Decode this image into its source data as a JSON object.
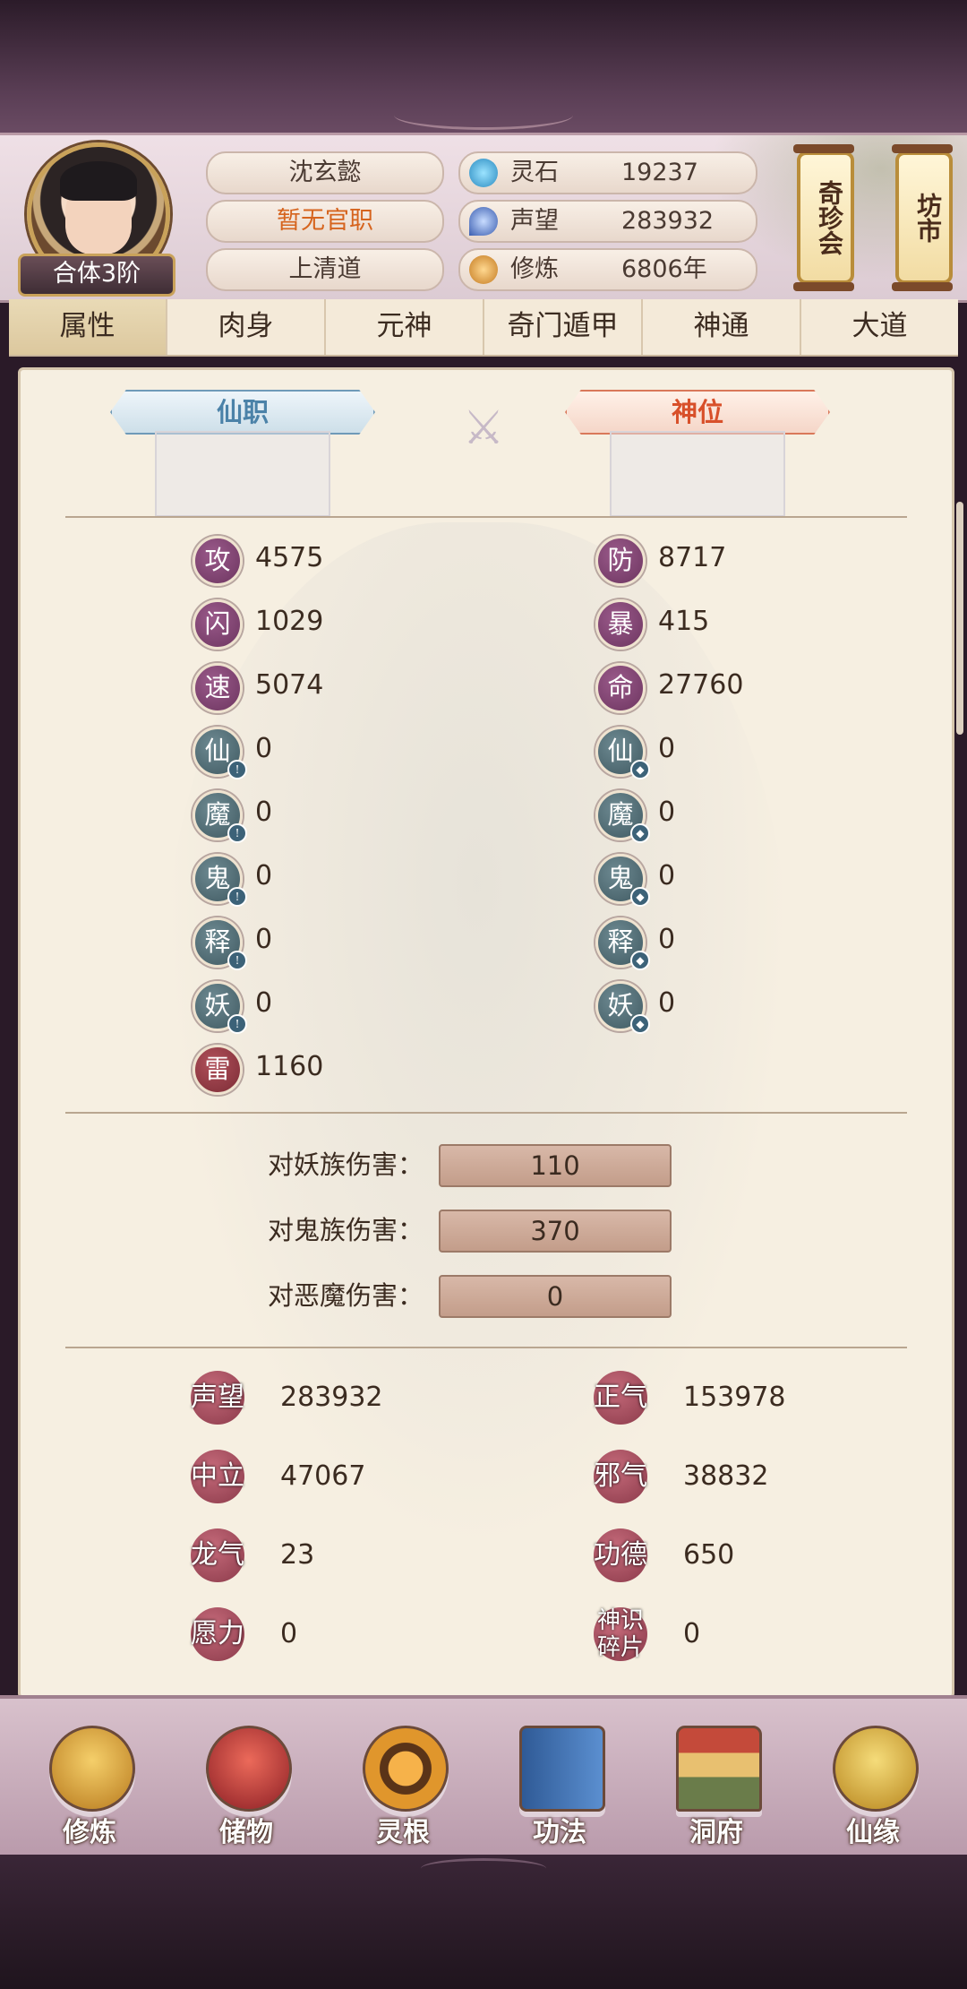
{
  "header": {
    "realm_badge": "合体3阶",
    "name": "沈玄懿",
    "official_title": "暂无官职",
    "sect": "上清道",
    "resources": [
      {
        "label": "灵石",
        "value": "19237",
        "icon": "spirit-stone-icon",
        "color": "#3aa6d8"
      },
      {
        "label": "声望",
        "value": "283932",
        "icon": "reputation-icon",
        "color": "#4a6fc4"
      },
      {
        "label": "修炼",
        "value": "6806年",
        "icon": "cultivation-icon",
        "color": "#d89a3a"
      }
    ],
    "shortcuts": [
      {
        "label": "奇珍会",
        "icon": "treasure-fair-scroll"
      },
      {
        "label": "坊市",
        "icon": "market-scroll"
      }
    ]
  },
  "tabs": [
    {
      "label": "属性",
      "active": true
    },
    {
      "label": "肉身",
      "active": false
    },
    {
      "label": "元神",
      "active": false
    },
    {
      "label": "奇门遁甲",
      "active": false
    },
    {
      "label": "神通",
      "active": false
    },
    {
      "label": "大道",
      "active": false
    }
  ],
  "ranks": {
    "left_label": "仙职",
    "right_label": "神位"
  },
  "stats_left": [
    {
      "char": "攻",
      "value": "4575",
      "kind": "purple"
    },
    {
      "char": "闪",
      "value": "1029",
      "kind": "purple"
    },
    {
      "char": "速",
      "value": "5074",
      "kind": "purple"
    },
    {
      "char": "仙",
      "value": "0",
      "kind": "teal"
    },
    {
      "char": "魔",
      "value": "0",
      "kind": "teal"
    },
    {
      "char": "鬼",
      "value": "0",
      "kind": "teal"
    },
    {
      "char": "释",
      "value": "0",
      "kind": "teal"
    },
    {
      "char": "妖",
      "value": "0",
      "kind": "teal"
    },
    {
      "char": "雷",
      "value": "1160",
      "kind": "red"
    }
  ],
  "stats_right": [
    {
      "char": "防",
      "value": "8717",
      "kind": "purple"
    },
    {
      "char": "暴",
      "value": "415",
      "kind": "purple"
    },
    {
      "char": "命",
      "value": "27760",
      "kind": "purple"
    },
    {
      "char": "仙",
      "value": "0",
      "kind": "teal"
    },
    {
      "char": "魔",
      "value": "0",
      "kind": "teal"
    },
    {
      "char": "鬼",
      "value": "0",
      "kind": "teal"
    },
    {
      "char": "释",
      "value": "0",
      "kind": "teal"
    },
    {
      "char": "妖",
      "value": "0",
      "kind": "teal"
    }
  ],
  "damage": [
    {
      "label": "对妖族伤害：",
      "value": "110"
    },
    {
      "label": "对鬼族伤害：",
      "value": "370"
    },
    {
      "label": "对恶魔伤害：",
      "value": "0"
    }
  ],
  "extras_left": [
    {
      "label": "声望",
      "value": "283932"
    },
    {
      "label": "中立",
      "value": "47067"
    },
    {
      "label": "龙气",
      "value": "23"
    },
    {
      "label": "愿力",
      "value": "0"
    }
  ],
  "extras_right": [
    {
      "label": "正气",
      "value": "153978"
    },
    {
      "label": "邪气",
      "value": "38832"
    },
    {
      "label": "功德",
      "value": "650"
    },
    {
      "label": "神识碎片",
      "value": "0"
    }
  ],
  "bottom_nav": [
    {
      "label": "修炼",
      "icon": "cultivate-icon",
      "color": "#d7a23a"
    },
    {
      "label": "储物",
      "icon": "storage-bag-icon",
      "color": "#c8433f"
    },
    {
      "label": "灵根",
      "icon": "spirit-root-icon",
      "color": "#d98d2c"
    },
    {
      "label": "功法",
      "icon": "technique-book-icon",
      "color": "#4a7cbf"
    },
    {
      "label": "洞府",
      "icon": "cave-dwelling-icon",
      "color": "#c9a04a"
    },
    {
      "label": "仙缘",
      "icon": "immortal-fate-icon",
      "color": "#d9b040"
    }
  ]
}
